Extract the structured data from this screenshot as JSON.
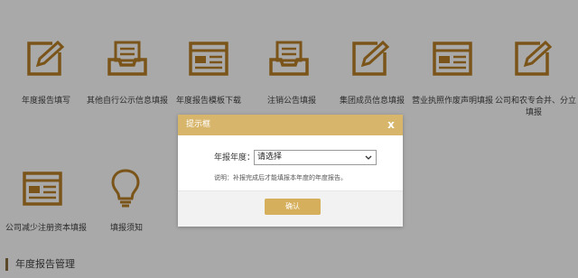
{
  "colors": {
    "overlay_background": "#a9a9a9",
    "icon_brown": "#7a5418",
    "dialog_header": "#d7b56a",
    "confirm_button": "#d6af5c"
  },
  "tiles": [
    {
      "label": "年度报告填写",
      "icon": "edit-pencil-icon"
    },
    {
      "label": "其他自行公示信息填报",
      "icon": "inbox-tray-icon"
    },
    {
      "label": "年度报告模板下载",
      "icon": "browser-window-icon"
    },
    {
      "label": "注销公告填报",
      "icon": "inbox-tray-icon"
    },
    {
      "label": "集团成员信息填报",
      "icon": "edit-pencil-icon"
    },
    {
      "label": "营业执照作废声明填报",
      "icon": "browser-window-icon"
    },
    {
      "label_line1": "公司和农专合并、分立",
      "label_line2": "填报",
      "icon": "edit-pencil-icon"
    },
    {
      "label": "公司减少注册资本填报",
      "icon": "browser-window-icon"
    },
    {
      "label": "填报须知",
      "icon": "lightbulb-icon"
    }
  ],
  "section": {
    "title": "年度报告管理"
  },
  "dialog": {
    "title": "提示框",
    "close_label": "x",
    "field_label": "年报年度：",
    "select_value": "请选择",
    "note": "说明：补报完成后才能填报本年度的年度报告。",
    "confirm_label": "确认"
  }
}
